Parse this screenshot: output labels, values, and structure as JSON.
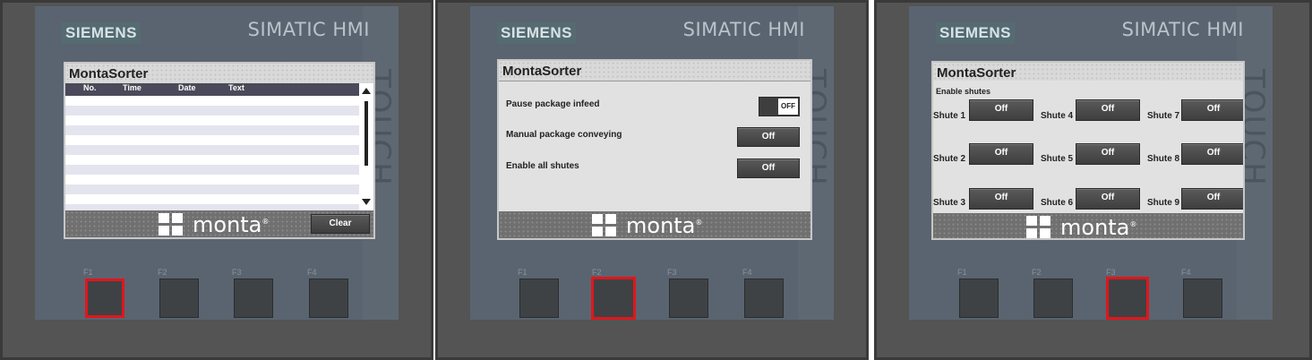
{
  "device": {
    "brand": "SIEMENS",
    "model": "SIMATIC HMI",
    "side_label": "TOUCH",
    "fkeys": [
      "F1",
      "F2",
      "F3",
      "F4"
    ]
  },
  "app": {
    "title": "MontaSorter",
    "logo_text": "monta",
    "logo_mark": "®"
  },
  "screen1": {
    "columns": [
      "No.",
      "Time",
      "Date",
      "Text"
    ],
    "clear_label": "Clear",
    "active_fkey": "F1"
  },
  "screen2": {
    "rows": [
      {
        "label": "Pause package infeed",
        "control": "toggle",
        "value": "OFF"
      },
      {
        "label": "Manual package conveying",
        "control": "button",
        "value": "Off"
      },
      {
        "label": "Enable all shutes",
        "control": "button",
        "value": "Off"
      }
    ],
    "active_fkey": "F2"
  },
  "screen3": {
    "heading": "Enable shutes",
    "shutes": [
      {
        "label": "Shute 1",
        "value": "Off"
      },
      {
        "label": "Shute 2",
        "value": "Off"
      },
      {
        "label": "Shute 3",
        "value": "Off"
      },
      {
        "label": "Shute 4",
        "value": "Off"
      },
      {
        "label": "Shute 5",
        "value": "Off"
      },
      {
        "label": "Shute 6",
        "value": "Off"
      },
      {
        "label": "Shute 7",
        "value": "Off"
      },
      {
        "label": "Shute 8",
        "value": "Off"
      },
      {
        "label": "Shute 9",
        "value": "Off"
      }
    ],
    "active_fkey": "F3"
  },
  "colors": {
    "active_key": "#e0161c",
    "brand_bg": "#556b72",
    "table_header": "#4a4a5a"
  }
}
